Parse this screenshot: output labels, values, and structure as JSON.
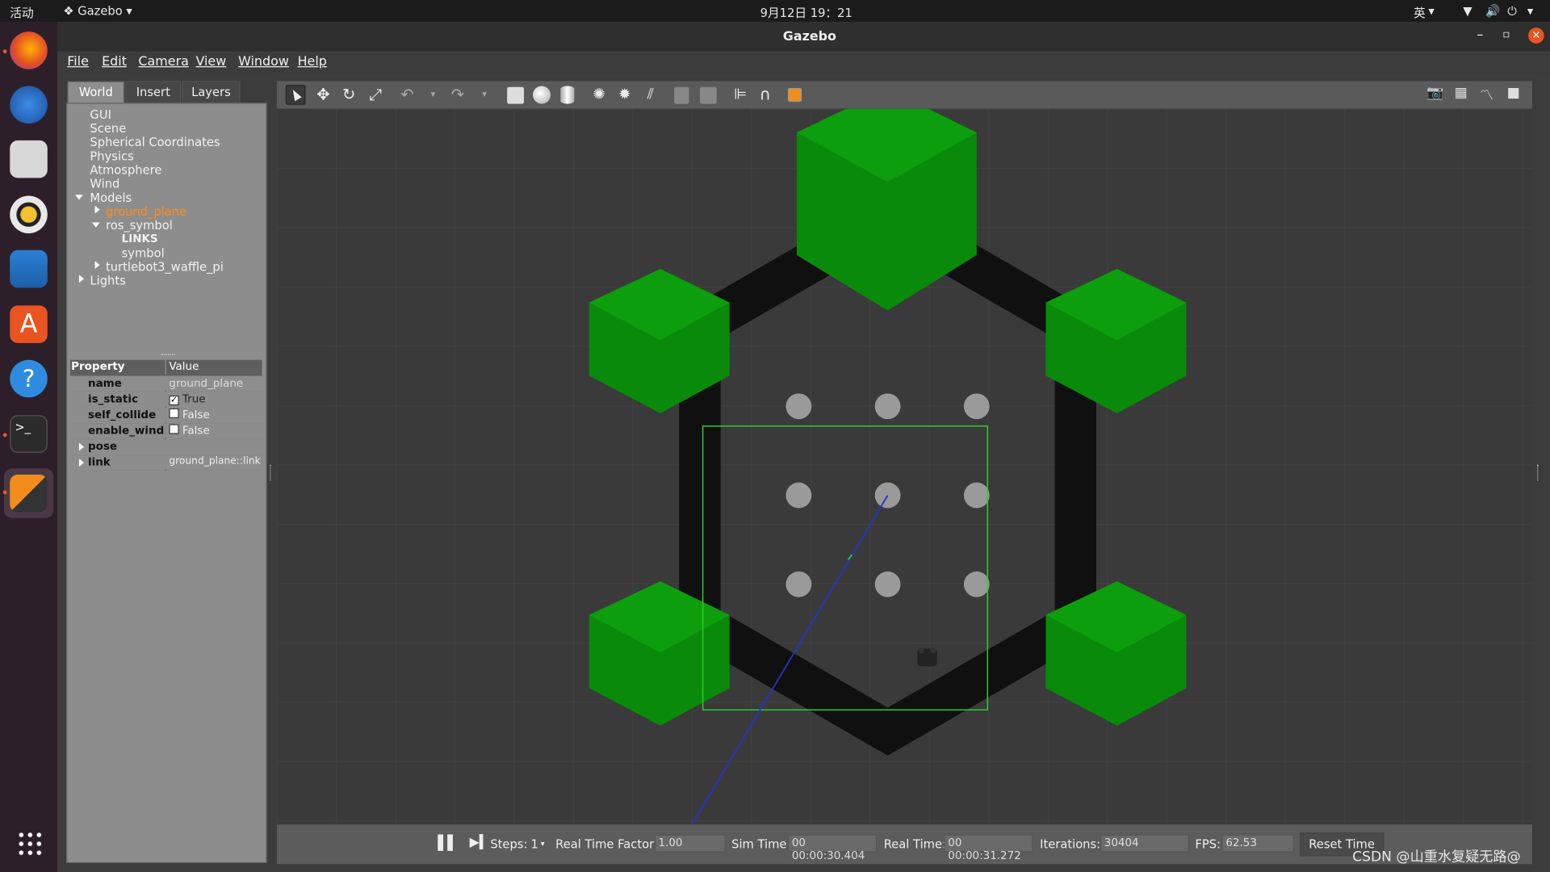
{
  "topbar": {
    "activities": "活动",
    "app_menu": "Gazebo",
    "clock": "9月12日  19：21",
    "lang": "英"
  },
  "window": {
    "title": "Gazebo"
  },
  "menu": {
    "file": "File",
    "edit": "Edit",
    "camera": "Camera",
    "view": "View",
    "window": "Window",
    "help": "Help"
  },
  "tabs": {
    "world": "World",
    "insert": "Insert",
    "layers": "Layers"
  },
  "tree": {
    "gui": "GUI",
    "scene": "Scene",
    "spherical": "Spherical Coordinates",
    "physics": "Physics",
    "atmosphere": "Atmosphere",
    "wind": "Wind",
    "models": "Models",
    "ground_plane": "ground_plane",
    "ros_symbol": "ros_symbol",
    "links": "LINKS",
    "symbol": "symbol",
    "turtlebot": "turtlebot3_waffle_pi",
    "lights": "Lights"
  },
  "props": {
    "header_property": "Property",
    "header_value": "Value",
    "name_k": "name",
    "name_v": "ground_plane",
    "static_k": "is_static",
    "static_v": "True",
    "collide_k": "self_collide",
    "collide_v": "False",
    "wind_k": "enable_wind",
    "wind_v": "False",
    "pose_k": "pose",
    "link_k": "link",
    "link_v": "ground_plane::link"
  },
  "status": {
    "steps_label": "Steps:",
    "steps_value": "1",
    "rtf_label": "Real Time Factor:",
    "rtf_value": "1.00",
    "sim_label": "Sim Time:",
    "sim_value": "00 00:00:30.404",
    "real_label": "Real Time:",
    "real_value": "00 00:00:31.272",
    "iter_label": "Iterations:",
    "iter_value": "30404",
    "fps_label": "FPS:",
    "fps_value": "62.53",
    "reset_label": "Reset Time"
  },
  "watermark": "CSDN @山重水复疑无路@",
  "colors": {
    "hex_green": "#0a8a0a",
    "selection": "#2ecc2e",
    "ground_highlight": "#ff8c1a"
  }
}
